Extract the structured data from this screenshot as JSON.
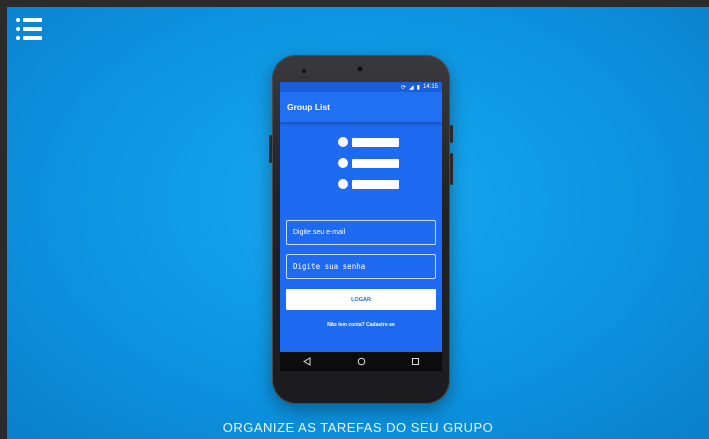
{
  "page": {
    "tagline": "ORGANIZE AS TAREFAS DO SEU GRUPO",
    "background_color": "#0c95e2"
  },
  "header": {
    "menu_icon": "list-menu-icon"
  },
  "phone": {
    "status": {
      "time": "14:15"
    },
    "app": {
      "title": "Group List",
      "accent_color": "#1e6bf2",
      "logo_icon": "list-icon",
      "email": {
        "placeholder": "Digite seu e-mail"
      },
      "password": {
        "placeholder": "Digite sua senha"
      },
      "login_label": "LOGAR",
      "signup_text": "Não tem conta? Cadastre-se"
    },
    "nav": {
      "back_icon": "back-triangle-icon",
      "home_icon": "home-circle-icon",
      "recent_icon": "recent-square-icon"
    }
  }
}
